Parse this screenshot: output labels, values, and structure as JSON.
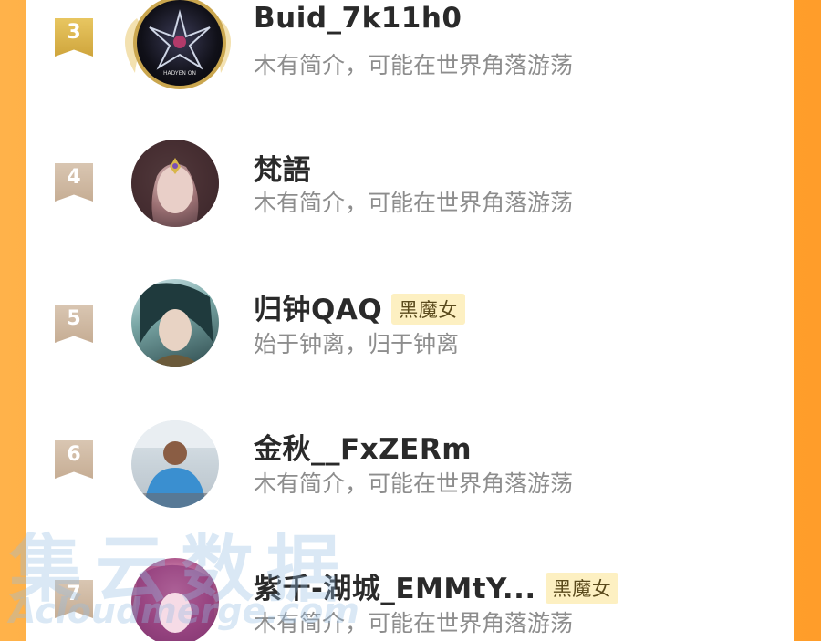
{
  "colors": {
    "background": "#ffa531",
    "card": "#ffffff",
    "rank_gold": "#d9b14a",
    "rank_plain": "#cdb49c",
    "badge_bg": "#fdf0c2",
    "name_text": "#2a2a2a",
    "bio_text": "#8d8d8d"
  },
  "rows": [
    {
      "rank": "3",
      "name": "Buid_7k11h0",
      "badge": "",
      "bio": "木有简介，可能在世界角落游荡",
      "avatar": "dark-emblem-avatar"
    },
    {
      "rank": "4",
      "name": "梵語",
      "badge": "",
      "bio": "木有简介，可能在世界角落游荡",
      "avatar": "anime-girl-avatar"
    },
    {
      "rank": "5",
      "name": "归钟QAQ",
      "badge": "黑魔女",
      "bio": "始于钟离，归于钟离",
      "avatar": "anime-boy-avatar"
    },
    {
      "rank": "6",
      "name": "金秋__FxZERm",
      "badge": "",
      "bio": "木有简介，可能在世界角落游荡",
      "avatar": "photo-man-avatar"
    },
    {
      "rank": "7",
      "name": "紫千-湖城_EMMtY...",
      "badge": "黑魔女",
      "bio": "木有简介，可能在世界角落游荡",
      "avatar": "pink-anime-avatar"
    }
  ],
  "watermark": {
    "main": "集云数据",
    "sub": "Acloudmerge.com"
  }
}
